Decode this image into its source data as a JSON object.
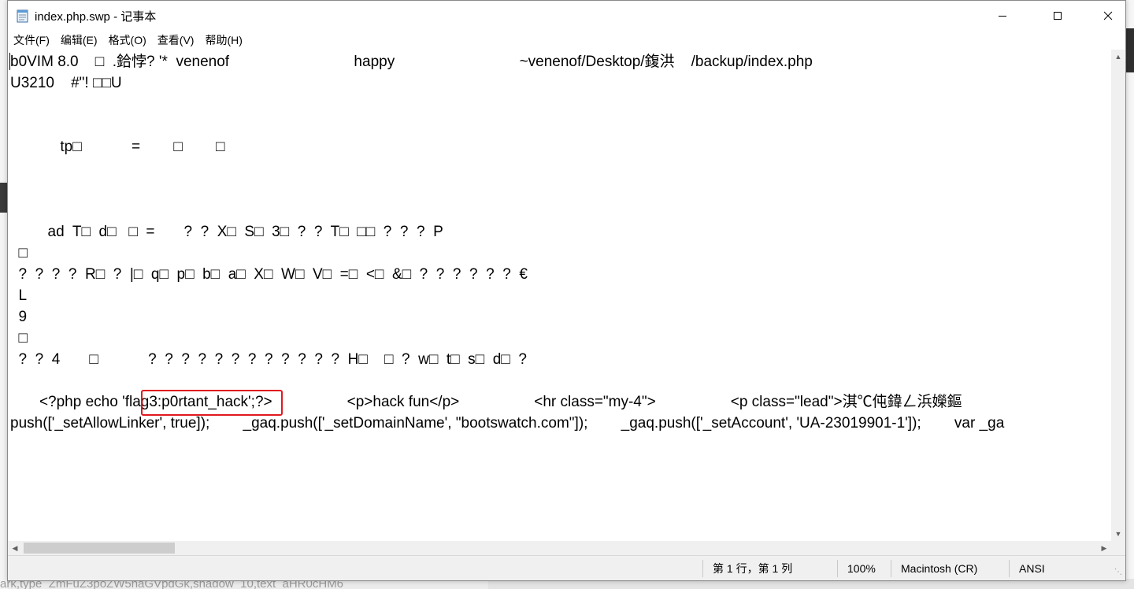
{
  "window": {
    "title": "index.php.swp - 记事本",
    "minimize_icon": "minimize-icon",
    "maximize_icon": "maximize-icon",
    "close_icon": "close-icon"
  },
  "menu": [
    {
      "label": "文件(F)"
    },
    {
      "label": "编辑(E)"
    },
    {
      "label": "格式(O)"
    },
    {
      "label": "查看(V)"
    },
    {
      "label": "帮助(H)"
    }
  ],
  "editor": {
    "lines": [
      {
        "text": "b0VIM 8.0    □  .鉿悖? '*  venenof                              happy                              ~venenof/Desktop/鍑洪    /backup/index.php"
      },
      {
        "text": "U3210    #\"! □□U"
      },
      {
        "text": "            tp□            =        □        □"
      },
      {
        "text": "         ad  T□  d□   □  =       ?  ?  X□  S□  3□  ?  ?  T□  □□  ?  ?  ?  P"
      },
      {
        "text": "  □"
      },
      {
        "text": "  ?  ?  ?  ?  R□  ?  |□  q□  p□  b□  a□  X□  W□  V□  =□  <□  &□  ?  ?  ?  ?  ?  ?  €"
      },
      {
        "text": "  L"
      },
      {
        "text": "  9"
      },
      {
        "text": "  □"
      },
      {
        "text": "  ?  ?  4       □            ?  ?  ?  ?  ?  ?  ?  ?  ?  ?  ?  ?  H□    □  ?  w□  t□  s□  d□  ?"
      },
      {
        "text": "       <?php echo 'flag3:p0rtant_hack';?>                  <p>hack fun</p>                  <hr class=\"my-4\">                  <p class=\"lead\">淇℃伅鍏ㄥ浜嬫鏂"
      },
      {
        "text": "push(['_setAllowLinker', true]);        _gaq.push(['_setDomainName', \"bootswatch.com\"]);        _gaq.push(['_setAccount', 'UA-23019901-1']);        var _ga"
      }
    ]
  },
  "highlight": {
    "text": "flag3:p0rtant_hack",
    "color": "#e0191f"
  },
  "status": {
    "position": "第 1 行，第 1 列",
    "zoom": "100%",
    "line_ending": "Macintosh (CR)",
    "encoding": "ANSI"
  },
  "background": {
    "bottom_text": "ark,type_ZmFuZ3poZW5naGVpdGk,shadow_10,text_aHR0cHM6"
  }
}
